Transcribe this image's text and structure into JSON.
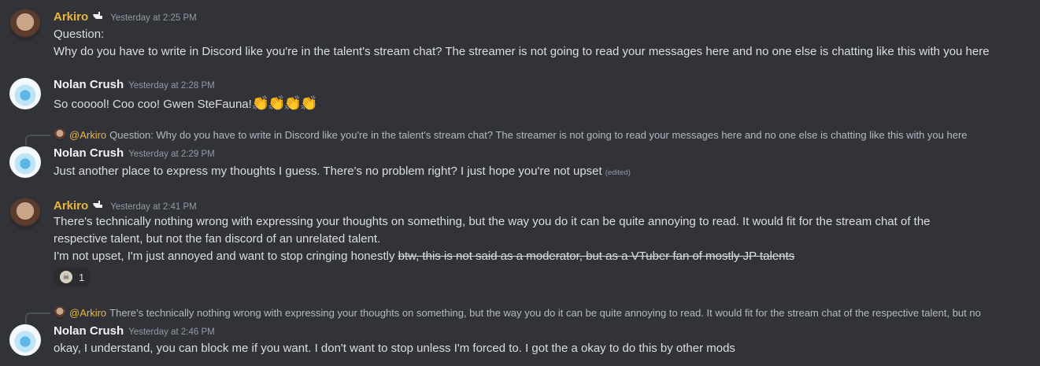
{
  "messages": [
    {
      "author": "Arkiro",
      "timestamp": "Yesterday at 2:25 PM",
      "lines": [
        "Question:",
        "Why do you have to write in Discord like you're in the talent's stream chat? The streamer is not going to read your messages here and no one else is chatting like this with you here"
      ]
    },
    {
      "author": "Nolan Crush",
      "timestamp": "Yesterday at 2:28 PM",
      "text": "So cooool! Coo coo!  Gwen SteFauna!",
      "emojis": "👏👏👏👏"
    },
    {
      "reply": {
        "mention": "@Arkiro",
        "text": "Question: Why do you have to write in Discord like you're in the talent's stream chat? The streamer is not going to read your messages here and no one else is chatting like this with you here"
      },
      "author": "Nolan Crush",
      "timestamp": "Yesterday at 2:29 PM",
      "text": "Just another place to express my thoughts I guess. There's no problem right? I just hope you're not upset",
      "edited": "(edited)"
    },
    {
      "author": "Arkiro",
      "timestamp": "Yesterday at 2:41 PM",
      "lines": [
        "There's technically nothing wrong with expressing your thoughts on something, but the way you do it can be quite annoying to read. It would fit for the stream chat of the",
        "respective talent, but not the fan discord of an unrelated talent."
      ],
      "last_line": "I'm not upset, I'm just annoyed and want to stop cringing honestly ",
      "strike": "btw, this is not said as a moderator, but as a VTuber fan of mostly JP talents",
      "reaction_count": "1"
    },
    {
      "reply": {
        "mention": "@Arkiro",
        "text": "There's technically nothing wrong with expressing your thoughts on something, but the way you do it can be quite annoying to read. It would fit for the stream chat of the respective talent, but no"
      },
      "author": "Nolan Crush",
      "timestamp": "Yesterday at 2:46 PM",
      "text": "okay, I understand, you can block me if you want. I don't want to stop unless I'm forced to. I got the a okay to do this by other mods"
    }
  ],
  "colors": {
    "background": "#313338",
    "arkiro_name": "#e9b73b",
    "text": "#dbdee1",
    "timestamp": "#949ba4"
  },
  "icons": {
    "arkiro_badge": "hand-pointer-icon",
    "reaction": "skull-emoji-icon"
  }
}
